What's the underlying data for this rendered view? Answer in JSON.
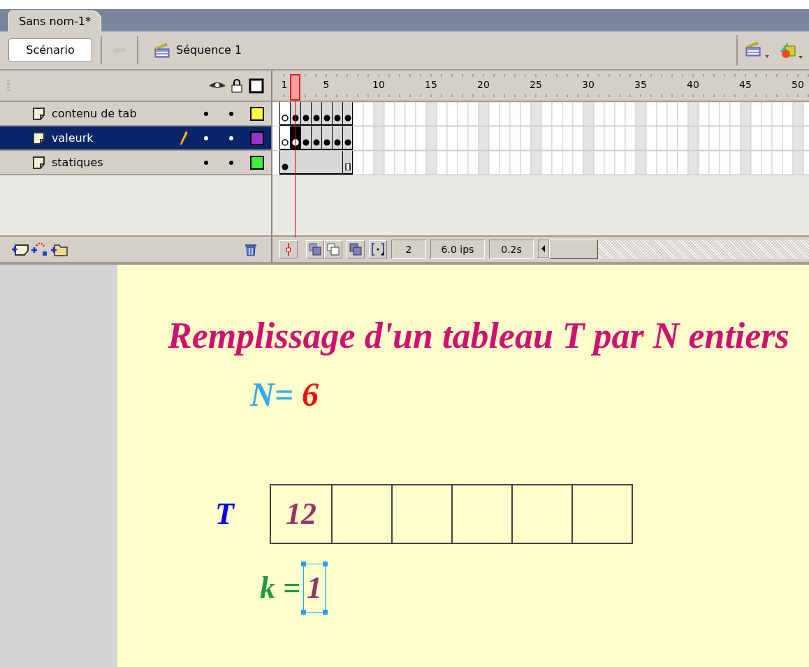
{
  "document_tab": {
    "label": "Sans nom-1*",
    "selected": true
  },
  "toolbar": {
    "scene_button": "Scénario",
    "sequence": "Séquence 1"
  },
  "ruler": [
    "1",
    "5",
    "10",
    "15",
    "20",
    "25",
    "30",
    "35",
    "40",
    "45",
    "50"
  ],
  "layers": [
    {
      "name": "contenu de tab",
      "selected": false,
      "editing": false,
      "color": "#ffff40",
      "frames": [
        {
          "kind": "empty_key",
          "selected": false
        },
        {
          "kind": "key",
          "selected": false
        },
        {
          "kind": "key",
          "selected": false
        },
        {
          "kind": "key",
          "selected": false
        },
        {
          "kind": "key",
          "selected": false
        },
        {
          "kind": "key",
          "selected": false
        },
        {
          "kind": "key",
          "selected": false
        }
      ]
    },
    {
      "name": "valeurk",
      "selected": true,
      "editing": true,
      "color": "#9933cc",
      "frames": [
        {
          "kind": "empty_key",
          "selected": false
        },
        {
          "kind": "empty_key",
          "selected": true
        },
        {
          "kind": "key",
          "selected": false
        },
        {
          "kind": "key",
          "selected": false
        },
        {
          "kind": "key",
          "selected": false
        },
        {
          "kind": "key",
          "selected": false
        },
        {
          "kind": "key",
          "selected": false
        }
      ]
    },
    {
      "name": "statiques",
      "selected": false,
      "editing": false,
      "color": "#40ee40",
      "frames": [
        {
          "kind": "key",
          "selected": false
        },
        {
          "kind": "span",
          "selected": false
        },
        {
          "kind": "span",
          "selected": false
        },
        {
          "kind": "span",
          "selected": false
        },
        {
          "kind": "span",
          "selected": false
        },
        {
          "kind": "span",
          "selected": false
        },
        {
          "kind": "end",
          "selected": false
        }
      ]
    }
  ],
  "status": {
    "frame": "2",
    "rate": "6.0 ips",
    "time": "0.2s"
  },
  "stage": {
    "title": "Remplissage d'un tableau T par N entiers",
    "n_label": "N=",
    "n_value": "6",
    "t_label": "T",
    "cells": [
      "12",
      "",
      "",
      "",
      "",
      ""
    ],
    "k_label": "k =",
    "k_value": "1"
  }
}
